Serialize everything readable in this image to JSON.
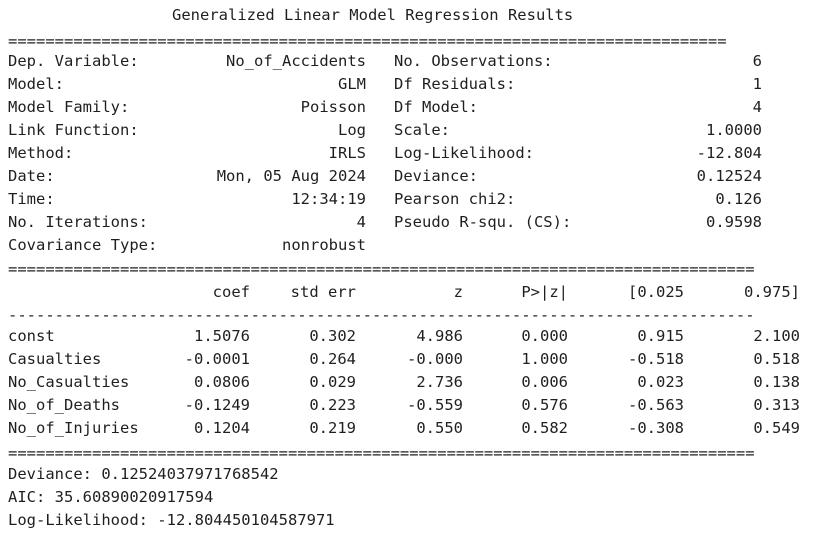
{
  "title": "Generalized Linear Model Regression Results",
  "rule_eq": "=============================================================================",
  "rule_eq_wide": "================================================================================",
  "rule_dash": "--------------------------------------------------------------------------------",
  "summary_left": [
    {
      "label": "Dep. Variable:",
      "value": "No_of_Accidents"
    },
    {
      "label": "Model:",
      "value": "GLM"
    },
    {
      "label": "Model Family:",
      "value": "Poisson"
    },
    {
      "label": "Link Function:",
      "value": "Log"
    },
    {
      "label": "Method:",
      "value": "IRLS"
    },
    {
      "label": "Date:",
      "value": "Mon, 05 Aug 2024"
    },
    {
      "label": "Time:",
      "value": "12:34:19"
    },
    {
      "label": "No. Iterations:",
      "value": "4"
    },
    {
      "label": "Covariance Type:",
      "value": "nonrobust"
    }
  ],
  "summary_right": [
    {
      "label": "No. Observations:",
      "value": "6"
    },
    {
      "label": "Df Residuals:",
      "value": "1"
    },
    {
      "label": "Df Model:",
      "value": "4"
    },
    {
      "label": "Scale:",
      "value": "1.0000"
    },
    {
      "label": "Log-Likelihood:",
      "value": "-12.804"
    },
    {
      "label": "Deviance:",
      "value": "0.12524"
    },
    {
      "label": "Pearson chi2:",
      "value": "0.126"
    },
    {
      "label": "Pseudo R-squ. (CS):",
      "value": "0.9598"
    }
  ],
  "coef_headers": [
    "coef",
    "std err",
    "z",
    "P>|z|",
    "[0.025",
    "0.975]"
  ],
  "coef_rows": [
    {
      "name": "const",
      "values": [
        "1.5076",
        "0.302",
        "4.986",
        "0.000",
        "0.915",
        "2.100"
      ]
    },
    {
      "name": "Casualties",
      "values": [
        "-0.0001",
        "0.264",
        "-0.000",
        "1.000",
        "-0.518",
        "0.518"
      ]
    },
    {
      "name": "No_Casualties",
      "values": [
        "0.0806",
        "0.029",
        "2.736",
        "0.006",
        "0.023",
        "0.138"
      ]
    },
    {
      "name": "No_of_Deaths",
      "values": [
        "-0.1249",
        "0.223",
        "-0.559",
        "0.576",
        "-0.563",
        "0.313"
      ]
    },
    {
      "name": "No_of_Injuries",
      "values": [
        "0.1204",
        "0.219",
        "0.550",
        "0.582",
        "-0.308",
        "0.549"
      ]
    }
  ],
  "footer": [
    "Deviance: 0.12524037971768542",
    "AIC: 35.60890020917594",
    "Log-Likelihood: -12.804450104587971"
  ]
}
